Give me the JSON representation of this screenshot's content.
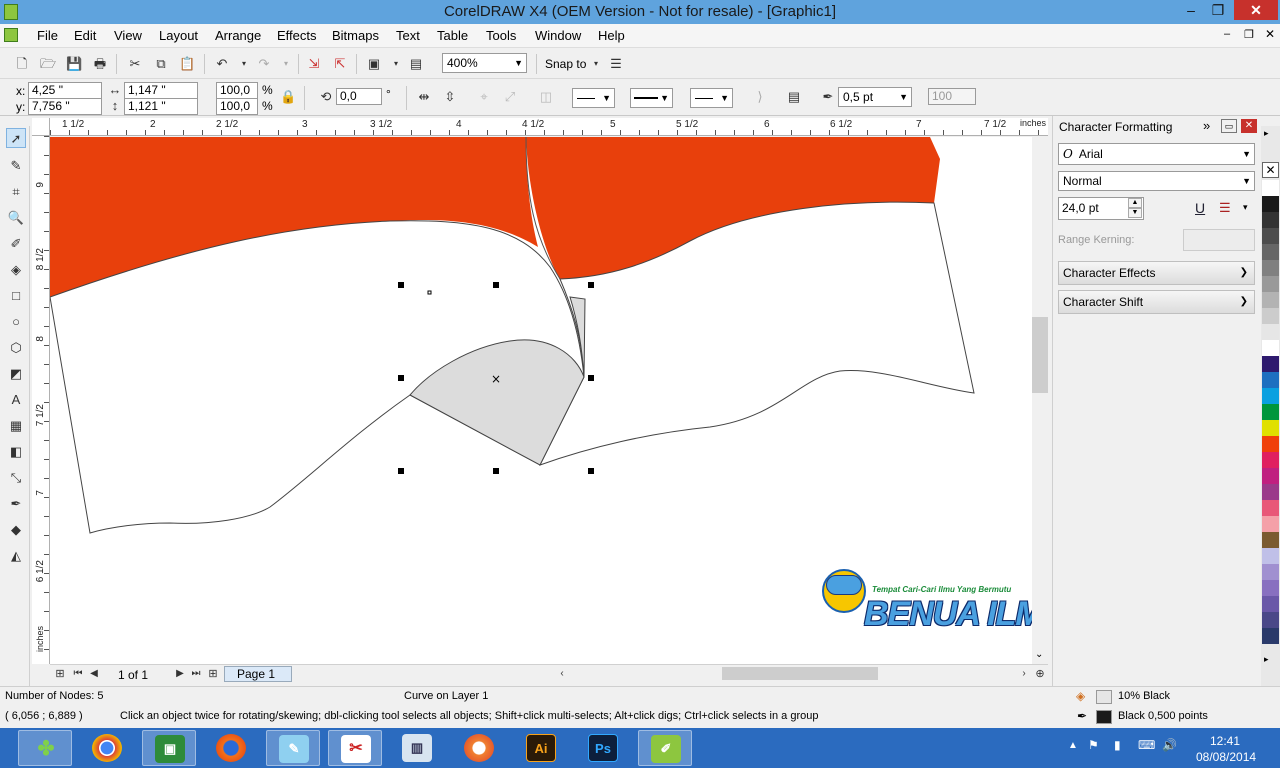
{
  "window": {
    "title": "CorelDRAW X4 (OEM Version - Not for resale) - [Graphic1]"
  },
  "menu": [
    "File",
    "Edit",
    "View",
    "Layout",
    "Arrange",
    "Effects",
    "Bitmaps",
    "Text",
    "Table",
    "Tools",
    "Window",
    "Help"
  ],
  "toolbar": {
    "zoom": "400%",
    "snap_to": "Snap to"
  },
  "propbar": {
    "x": "4,25 \"",
    "y": "7,756 \"",
    "width": "1,147 \"",
    "height": "1,121 \"",
    "scale_x": "100,0",
    "scale_y": "100,0",
    "pct1": "%",
    "pct2": "%",
    "rotation": "0,0",
    "deg": "°",
    "outline_width": "0,5 pt",
    "value_100": "100"
  },
  "rulers": {
    "unit": "inches",
    "h_labels": [
      "1 1/2",
      "2",
      "2 1/2",
      "3",
      "3 1/2",
      "4",
      "4 1/2",
      "5",
      "5 1/2",
      "6",
      "6 1/2",
      "7",
      "7 1/2"
    ],
    "v_labels": [
      "9",
      "8 1/2",
      "8",
      "7 1/2",
      "7",
      "6 1/2",
      "inches"
    ]
  },
  "docker": {
    "title": "Character Formatting",
    "font": "Arial",
    "style": "Normal",
    "size": "24,0 pt",
    "range_kerning": "Range Kerning:",
    "sections": [
      "Character Effects",
      "Character Shift"
    ]
  },
  "page_nav": {
    "count": "1 of 1",
    "page_tab": "Page 1"
  },
  "watermark": {
    "line1": "Tempat Cari-Cari Ilmu Yang Bermutu",
    "line2": "BENUA ILMU"
  },
  "status": {
    "nodes": "Number of Nodes: 5",
    "object": "Curve on Layer 1",
    "coords": "( 6,056 ; 6,889  )",
    "hint": "Click an object twice for rotating/skewing; dbl-clicking tool selects all objects; Shift+click multi-selects; Alt+click digs; Ctrl+click selects in a group",
    "fill": "10% Black",
    "outline": "Black  0,500 points"
  },
  "clock": {
    "time": "12:41",
    "date": "08/08/2014"
  },
  "colors": {
    "flag_red": "#e8400c",
    "titlebar": "#5fa3dd",
    "taskbar": "#2b6bbf",
    "shape_gray": "#dcdcdc"
  },
  "palette": [
    "#ffffff",
    "#1a1a1a",
    "#333333",
    "#4d4d4d",
    "#666666",
    "#808080",
    "#999999",
    "#b3b3b3",
    "#cccccc",
    "#e6e6e6",
    "#ffffff",
    "#2e1a6e",
    "#1e6fc0",
    "#0aa0e0",
    "#00963c",
    "#e0e000",
    "#f0400a",
    "#e02060",
    "#c02080",
    "#9b3a8a",
    "#e85878",
    "#f4a0a8",
    "#7a5a30",
    "#c0c0e8",
    "#a090d0",
    "#8870c0",
    "#6a58a8",
    "#4a4888",
    "#2a3a6a"
  ]
}
